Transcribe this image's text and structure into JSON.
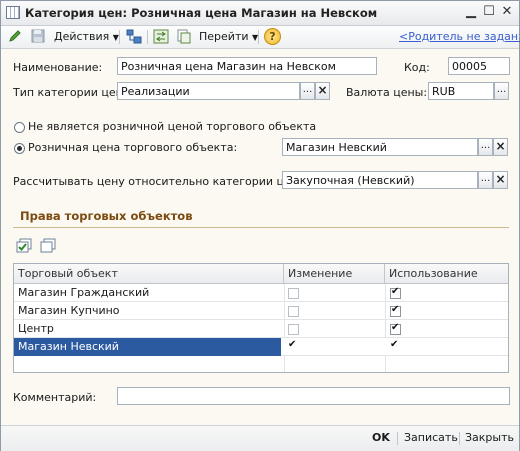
{
  "window": {
    "title": "Категория цен: Розничная цена Магазин на Невском",
    "minimize_glyph": "▁",
    "maximize_glyph": "☐",
    "close_glyph": "✕"
  },
  "toolbar": {
    "actions_label": "Действия",
    "goto_label": "Перейти",
    "help_label": "?",
    "parent_link": "<Родитель не задан>"
  },
  "form": {
    "name_label": "Наименование:",
    "name_value": "Розничная цена Магазин на Невском",
    "code_label": "Код:",
    "code_value": "00005",
    "type_label": "Тип категории цен:",
    "type_value": "Реализации",
    "currency_label": "Валюта цены:",
    "currency_value": "RUB",
    "radio_not_retail_label": "Не является розничной ценой торгового объекта",
    "radio_retail_label": "Розничная цена торгового объекта:",
    "retail_object_value": "Магазин Невский",
    "relative_label": "Рассчитывать цену относительно категории цен:",
    "relative_value": "Закупочная (Невский)",
    "ellipsis": "...",
    "clear": "×"
  },
  "rights": {
    "section_title": "Права торговых объектов",
    "columns": [
      "Торговый объект",
      "Изменение",
      "Использование"
    ],
    "rows": [
      {
        "name": "Магазин Гражданский",
        "change": false,
        "use": true
      },
      {
        "name": "Магазин Купчино",
        "change": false,
        "use": true
      },
      {
        "name": "Центр",
        "change": false,
        "use": true
      },
      {
        "name": "Магазин Невский",
        "change": true,
        "use": true,
        "selected": true
      }
    ]
  },
  "comment": {
    "label": "Комментарий:",
    "value": ""
  },
  "footer": {
    "ok_label": "OK",
    "save_label": "Записать",
    "close_label": "Закрыть"
  },
  "colors": {
    "accent_link": "#3a5fcd",
    "section_title": "#7c4a10",
    "selection": "#2c5aa0"
  }
}
